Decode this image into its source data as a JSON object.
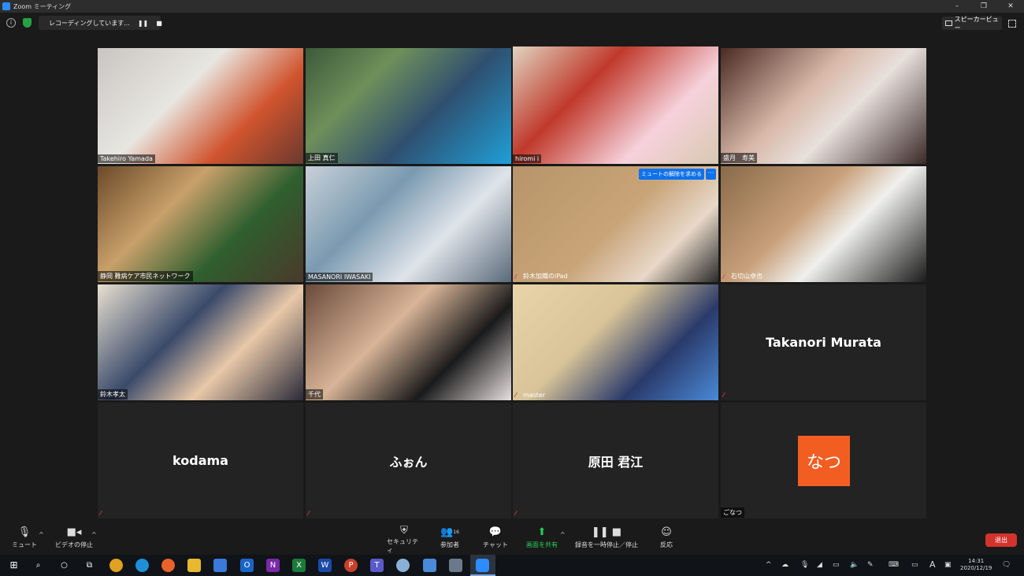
{
  "window": {
    "title": "Zoom ミーティング",
    "minimize": "–",
    "restore": "❐",
    "close": "✕"
  },
  "topbar": {
    "info_glyph": "i",
    "recording_text": "レコーディングしています...",
    "pause_glyph": "❚❚",
    "stop_glyph": "■",
    "speaker_view_label": "スピーカービュー"
  },
  "participants": [
    {
      "name": "Takehiro Yamada",
      "muted": false,
      "video": true,
      "bg": "linear-gradient(135deg,#c9c6c0 0%,#e8e6e0 40%,#d0542e 70%,#6b3a2e 100%)"
    },
    {
      "name": "上田 真仁",
      "muted": false,
      "video": true,
      "bg": "linear-gradient(135deg,#3b5a3a 0%,#6f8f5a 30%,#2f4f6f 60%,#1f9fd8 100%)"
    },
    {
      "name": "hiromi i",
      "muted": false,
      "video": true,
      "active": true,
      "bg": "linear-gradient(135deg,#e0d4c0 0%,#c0392b 35%,#f6d2dc 70%,#d8c8b0 100%)"
    },
    {
      "name": "盛月　寿美",
      "muted": false,
      "video": true,
      "bg": "linear-gradient(135deg,#4a2a22 0%,#d8b8a8 40%,#e8e0dc 60%,#3a2a28 100%)"
    },
    {
      "name": "静岡 難病ケア市民ネットワーク",
      "muted": false,
      "video": true,
      "bg": "linear-gradient(135deg,#6b4a2a 0%,#c8a06a 35%,#2f5f2f 65%,#4a3a2a 100%)"
    },
    {
      "name": "MASANORI IWASAKI",
      "muted": false,
      "video": true,
      "bg": "linear-gradient(135deg,#c8d0d8 0%,#7a9ab0 35%,#e0e4ea 65%,#5a6a7a 100%)"
    },
    {
      "name": "鈴木加織のiPad",
      "muted": true,
      "video": true,
      "unmute_request": "ミュートの解除を求める",
      "more": "···",
      "bg": "linear-gradient(135deg,#b8946a 0%,#c8a478 50%,#e8d8c8 75%,#2a2a2a 100%)"
    },
    {
      "name": "石切山卓也",
      "muted": true,
      "video": true,
      "bg": "linear-gradient(135deg,#8a6a4a 0%,#c8a07a 40%,#f0f0ee 60%,#1a1a1a 100%)"
    },
    {
      "name": "鈴木孝太",
      "muted": false,
      "video": true,
      "bg": "linear-gradient(135deg,#e8e0d0 0%,#3a4a6a 40%,#e8c8a8 65%,#2a2a3a 100%)"
    },
    {
      "name": "千代",
      "muted": false,
      "video": true,
      "bg": "linear-gradient(135deg,#6a4a3a 0%,#d8b498 40%,#1a1a1a 70%,#e8e0e0 100%)"
    },
    {
      "name": "master",
      "muted": true,
      "video": true,
      "bg": "linear-gradient(135deg,#e8d4a8 0%,#d8c498 40%,#2a3a6a 70%,#4a8ad8 100%)"
    },
    {
      "name": "Takanori Murata",
      "muted": true,
      "video": false
    },
    {
      "name": "kodama",
      "muted": true,
      "video": false
    },
    {
      "name": "ふぉん",
      "muted": true,
      "video": false
    },
    {
      "name": "原田 君江",
      "muted": true,
      "video": false
    },
    {
      "name": "ごなつ",
      "muted": false,
      "video": false,
      "avatar_text": "なつ",
      "avatar_color": "#f25d22"
    }
  ],
  "toolbar": {
    "mute_label": "ミュート",
    "video_label": "ビデオの停止",
    "security_label": "セキュリティ",
    "participants_label": "参加者",
    "participants_count": "16",
    "chat_label": "チャット",
    "share_label": "画面を共有",
    "record_label": "録音を一時停止／停止",
    "reactions_label": "反応",
    "leave_label": "退出"
  },
  "taskbar": {
    "time": "14:31",
    "date": "2020/12/19",
    "ime_label": "A"
  }
}
